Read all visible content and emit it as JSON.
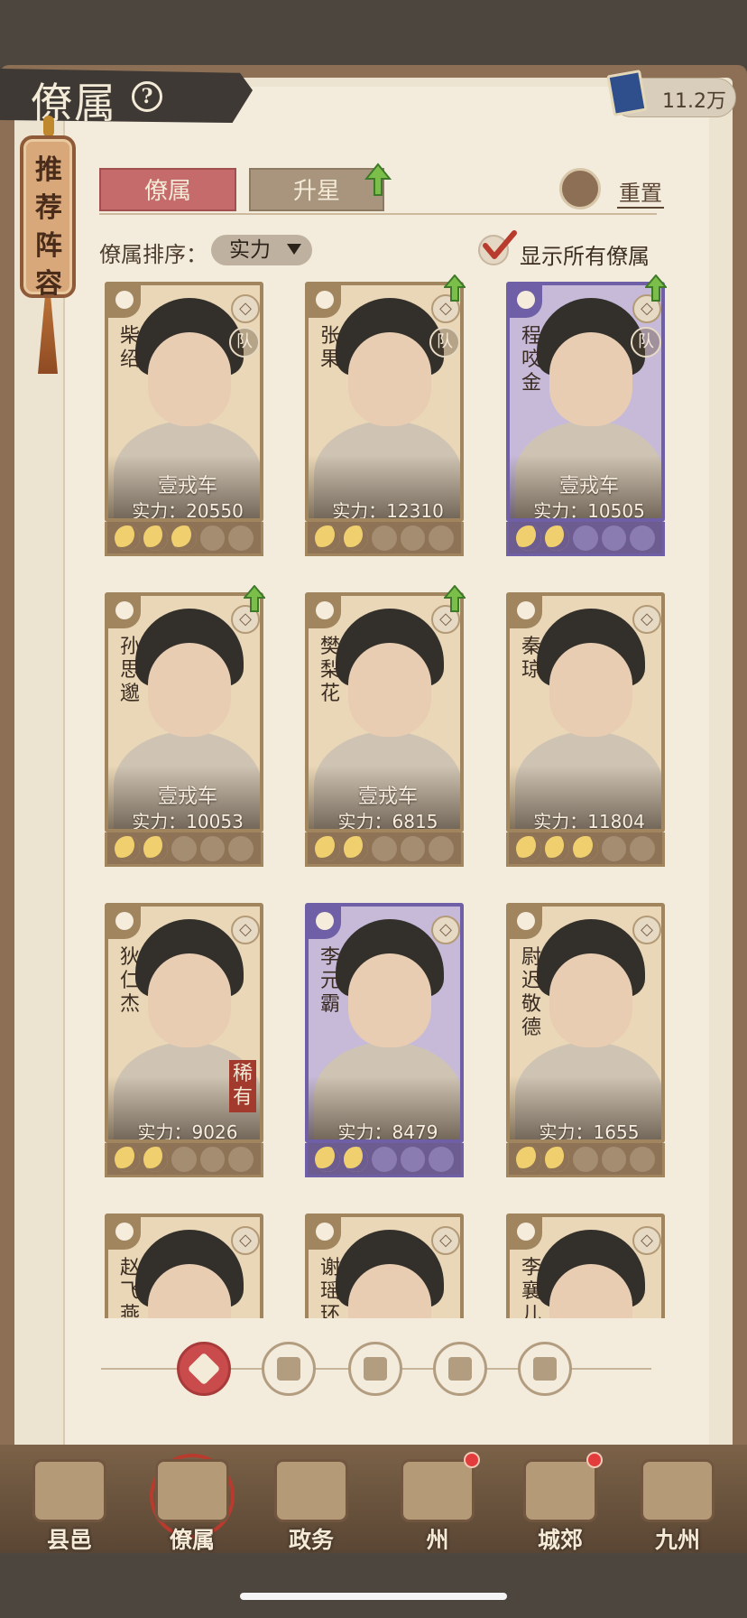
{
  "header": {
    "title": "僚属",
    "help_icon": "help-icon",
    "currency_value": "11.2万",
    "currency_icon": "book-icon"
  },
  "recommend": {
    "label": "推荐阵容"
  },
  "tabs": [
    {
      "label": "僚属",
      "active": true
    },
    {
      "label": "升星",
      "active": false
    }
  ],
  "reset": {
    "label": "重置"
  },
  "sort": {
    "label": "僚属排序：",
    "value": "实力"
  },
  "show_all": {
    "label": "显示所有僚属",
    "checked": true
  },
  "colors": {
    "active_tab": "#c66b6b",
    "purple_frame": "#6e5fa6",
    "brown_frame": "#a1855f",
    "badge_red": "#a23a2e"
  },
  "cards": [
    {
      "name": "柴绍",
      "title": "壹戎车",
      "power": "实力：20550",
      "stars": 3,
      "frame": "brown",
      "team": "队",
      "cls_icon": "sword-icon",
      "upgrade": false
    },
    {
      "name": "张果",
      "title": "",
      "power": "实力：12310",
      "stars": 2,
      "frame": "brown",
      "team": "队",
      "cls_icon": "taiji-icon",
      "upgrade": true
    },
    {
      "name": "程咬金",
      "title": "壹戎车",
      "power": "实力：10505",
      "stars": 2,
      "frame": "purple",
      "team": "队",
      "cls_icon": "shield-icon",
      "upgrade": true
    },
    {
      "name": "孙思邈",
      "title": "壹戎车",
      "power": "实力：10053",
      "stars": 2,
      "frame": "brown",
      "team": "",
      "cls_icon": "bowl-icon",
      "upgrade": true
    },
    {
      "name": "樊梨花",
      "title": "壹戎车",
      "power": "实力：6815",
      "stars": 2,
      "frame": "brown",
      "team": "",
      "cls_icon": "shield-icon",
      "upgrade": true
    },
    {
      "name": "秦琼",
      "title": "",
      "power": "实力：11804",
      "stars": 3,
      "frame": "brown",
      "team": "",
      "cls_icon": "sword-icon",
      "upgrade": false
    },
    {
      "name": "狄仁杰",
      "title": "",
      "power": "实力：9026",
      "stars": 2,
      "frame": "brown",
      "team": "",
      "cls_icon": "taiji-icon",
      "upgrade": false,
      "rarity": "稀有"
    },
    {
      "name": "李元霸",
      "title": "",
      "power": "实力：8479",
      "stars": 2,
      "frame": "purple",
      "team": "",
      "cls_icon": "shield-icon",
      "upgrade": false
    },
    {
      "name": "尉迟敬德",
      "title": "",
      "power": "实力：1655",
      "stars": 2,
      "frame": "brown",
      "team": "",
      "cls_icon": "sword-icon",
      "upgrade": false
    },
    {
      "name": "赵飞燕",
      "title": "",
      "power": "",
      "stars": 0,
      "frame": "brown",
      "team": "",
      "cls_icon": "sword-icon",
      "upgrade": false
    },
    {
      "name": "谢瑶环",
      "title": "",
      "power": "",
      "stars": 0,
      "frame": "brown",
      "team": "",
      "cls_icon": "sword-icon",
      "upgrade": false
    },
    {
      "name": "李襄儿",
      "title": "",
      "power": "",
      "stars": 0,
      "frame": "brown",
      "team": "",
      "cls_icon": "taiji-icon",
      "upgrade": false
    }
  ],
  "filters": [
    "all-filter-icon",
    "cap-filter-icon",
    "gourd-filter-icon",
    "fan-filter-icon",
    "horse-filter-icon"
  ],
  "nav": [
    {
      "label": "县邑",
      "icon": "county-icon",
      "active": false,
      "dot": false
    },
    {
      "label": "僚属",
      "icon": "officials-icon",
      "active": true,
      "dot": false
    },
    {
      "label": "政务",
      "icon": "affairs-icon",
      "active": false,
      "dot": false
    },
    {
      "label": "州",
      "icon": "prefecture-icon",
      "active": false,
      "dot": true
    },
    {
      "label": "城郊",
      "icon": "suburb-icon",
      "active": false,
      "dot": true
    },
    {
      "label": "九州",
      "icon": "map-icon",
      "active": false,
      "dot": false
    }
  ]
}
